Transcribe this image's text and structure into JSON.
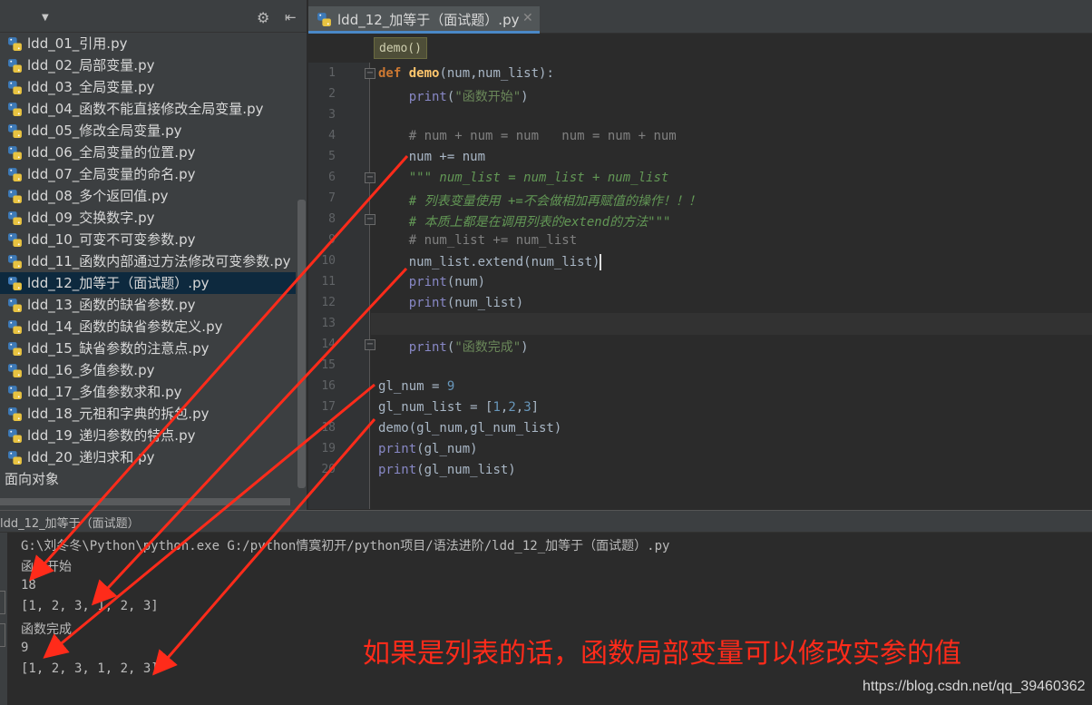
{
  "sidebar": {
    "files": [
      "ldd_01_引用.py",
      "ldd_02_局部变量.py",
      "ldd_03_全局变量.py",
      "ldd_04_函数不能直接修改全局变量.py",
      "ldd_05_修改全局变量.py",
      "ldd_06_全局变量的位置.py",
      "ldd_07_全局变量的命名.py",
      "ldd_08_多个返回值.py",
      "ldd_09_交换数字.py",
      "ldd_10_可变不可变参数.py",
      "ldd_11_函数内部通过方法修改可变参数.py",
      "ldd_12_加等于（面试题）.py",
      "ldd_13_函数的缺省参数.py",
      "ldd_14_函数的缺省参数定义.py",
      "ldd_15_缺省参数的注意点.py",
      "ldd_16_多值参数.py",
      "ldd_17_多值参数求和.py",
      "ldd_18_元祖和字典的拆包.py",
      "ldd_19_递归参数的特点.py",
      "ldd_20_递归求和.py"
    ],
    "selected_index": 11,
    "folder": "面向对象"
  },
  "editor": {
    "tab_title": "ldd_12_加等于（面试题）.py",
    "breadcrumb": "demo()",
    "line_numbers": [
      "1",
      "2",
      "3",
      "4",
      "5",
      "6",
      "7",
      "8",
      "9",
      "10",
      "11",
      "12",
      "13",
      "14",
      "15",
      "16",
      "17",
      "18",
      "19",
      "20"
    ]
  },
  "code": {
    "l1": {
      "kw": "def",
      "fn": "demo",
      "rest": "(num,num_list):"
    },
    "l2": {
      "bi": "print",
      "open": "(",
      "str": "\"函数开始\"",
      "close": ")"
    },
    "l4": {
      "cm": "# num + num = num   num = num + num"
    },
    "l5": {
      "text": "num += num"
    },
    "l6": {
      "doc": "\"\"\" num_list = num_list + num_list"
    },
    "l7": {
      "doc": "# 列表变量使用 +=不会做相加再赋值的操作！！！"
    },
    "l8": {
      "doc": "# 本质上都是在调用列表的extend的方法\"\"\""
    },
    "l9": {
      "cm": "# num_list += num_list"
    },
    "l10": {
      "a": "num_list.extend",
      "b": "(num_list)"
    },
    "l11": {
      "bi": "print",
      "rest": "(num)"
    },
    "l12": {
      "bi": "print",
      "rest": "(num_list)"
    },
    "l14": {
      "bi": "print",
      "open": "(",
      "str": "\"函数完成\"",
      "close": ")"
    },
    "l16": {
      "a": "gl_num = ",
      "num": "9"
    },
    "l17": {
      "a": "gl_num_list = [",
      "n1": "1",
      "c1": ",",
      "n2": "2",
      "c2": ",",
      "n3": "3",
      "b": "]"
    },
    "l18": {
      "text": "demo(gl_num,gl_num_list)"
    },
    "l19": {
      "bi": "print",
      "rest": "(gl_num)"
    },
    "l20": {
      "bi": "print",
      "rest": "(gl_num_list)"
    }
  },
  "run": {
    "tab_title": "ldd_12_加等于（面试题）",
    "output": [
      "G:\\刘冬冬\\Python\\python.exe G:/python情寞初开/python项目/语法进阶/ldd_12_加等于（面试题）.py",
      "函数开始",
      "18",
      "[1, 2, 3, 1, 2, 3]",
      "函数完成",
      "9",
      "[1, 2, 3, 1, 2, 3]"
    ]
  },
  "annotation": "如果是列表的话，函数局部变量可以修改实参的值",
  "watermark": "https://blog.csdn.net/qq_39460362",
  "colors": {
    "arrow": "#ff2b1a",
    "selection": "#0d293e",
    "tab_underline": "#4a88c7"
  }
}
